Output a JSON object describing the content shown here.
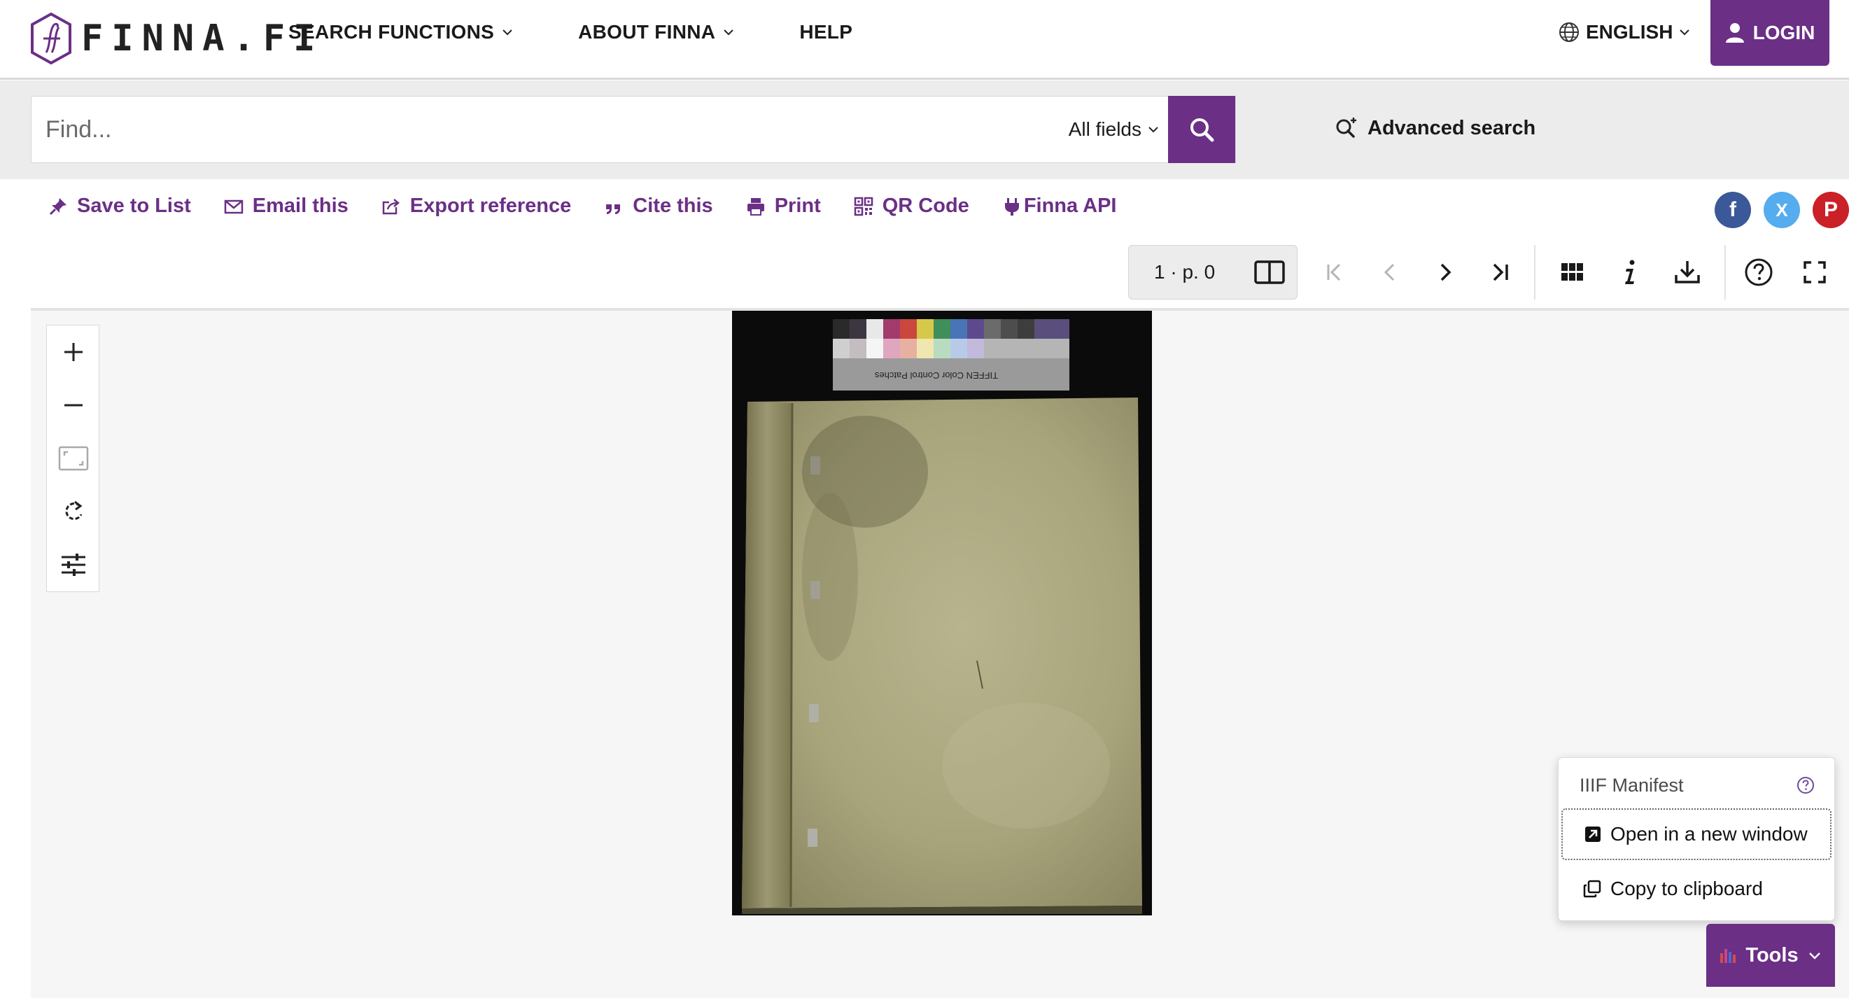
{
  "brand": {
    "name": "FINNA.FI"
  },
  "nav": {
    "items": [
      {
        "label": "SEARCH FUNCTIONS"
      },
      {
        "label": "ABOUT FINNA"
      },
      {
        "label": "HELP"
      }
    ],
    "language": "ENGLISH",
    "login": "LOGIN"
  },
  "search": {
    "placeholder": "Find...",
    "value": "",
    "field": "All fields",
    "advanced": "Advanced search"
  },
  "actions": [
    {
      "label": "Save to List",
      "icon": "pin-icon"
    },
    {
      "label": "Email this",
      "icon": "envelope-icon"
    },
    {
      "label": "Export reference",
      "icon": "export-icon"
    },
    {
      "label": "Cite this",
      "icon": "quote-icon"
    },
    {
      "label": "Print",
      "icon": "printer-icon"
    },
    {
      "label": "QR Code",
      "icon": "qr-code-icon"
    },
    {
      "label": "Finna API",
      "icon": "plug-icon"
    }
  ],
  "social": [
    {
      "name": "facebook",
      "glyph": "f",
      "color": "#3b5998"
    },
    {
      "name": "x",
      "glyph": "X",
      "color": "#55acee"
    },
    {
      "name": "pinterest",
      "glyph": "P",
      "color": "#cb2027"
    }
  ],
  "viewer": {
    "page_indicator": "1 · p. 0",
    "color_chart_text": "TIFFEN Color Control Patches"
  },
  "tools": {
    "label": "Tools",
    "menu_header": "IIIF Manifest",
    "menu_items": [
      {
        "label": "Open in a new window"
      },
      {
        "label": "Copy to clipboard"
      }
    ]
  },
  "colors": {
    "brand_purple": "#6b2f86",
    "background_gray": "#ececec"
  }
}
